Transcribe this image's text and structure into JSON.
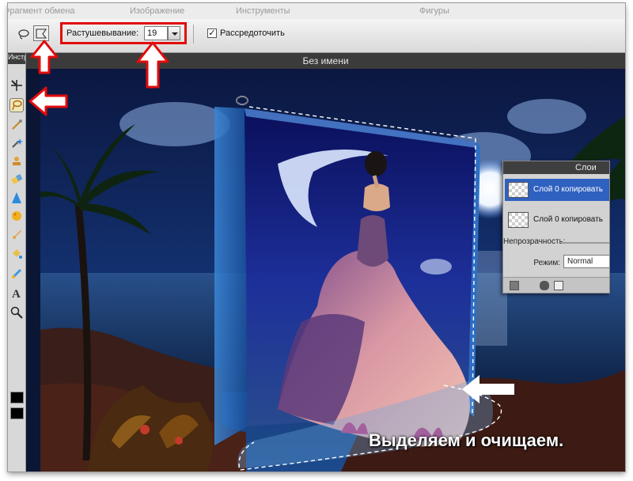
{
  "menubar": {
    "items": [
      "Фрагмент обмена",
      "Изображение",
      "Инструменты",
      "Фигуры"
    ]
  },
  "options_bar": {
    "feather_label": "Растушевывание:",
    "feather_value": "19",
    "scatter_label": "Рассредоточить",
    "scatter_checked": true,
    "scatter_check_glyph": "✓"
  },
  "toolbox": {
    "title": "Инструменты",
    "text_tool_glyph": "A"
  },
  "document": {
    "title": "Без имени"
  },
  "layers_panel": {
    "title": "Слои",
    "layers": [
      {
        "name": "Слой 0 копировать",
        "selected": true
      },
      {
        "name": "Слой 0 копировать",
        "selected": false
      }
    ],
    "opacity_label": "Непрозрачность:",
    "mode_label": "Режим:",
    "mode_value": "Normal"
  },
  "caption": "Выделяем и очищаем.",
  "colors": {
    "highlight_red": "#e20b0b",
    "selection_blue": "#2f61c0",
    "night_sky": "#0a1634"
  }
}
